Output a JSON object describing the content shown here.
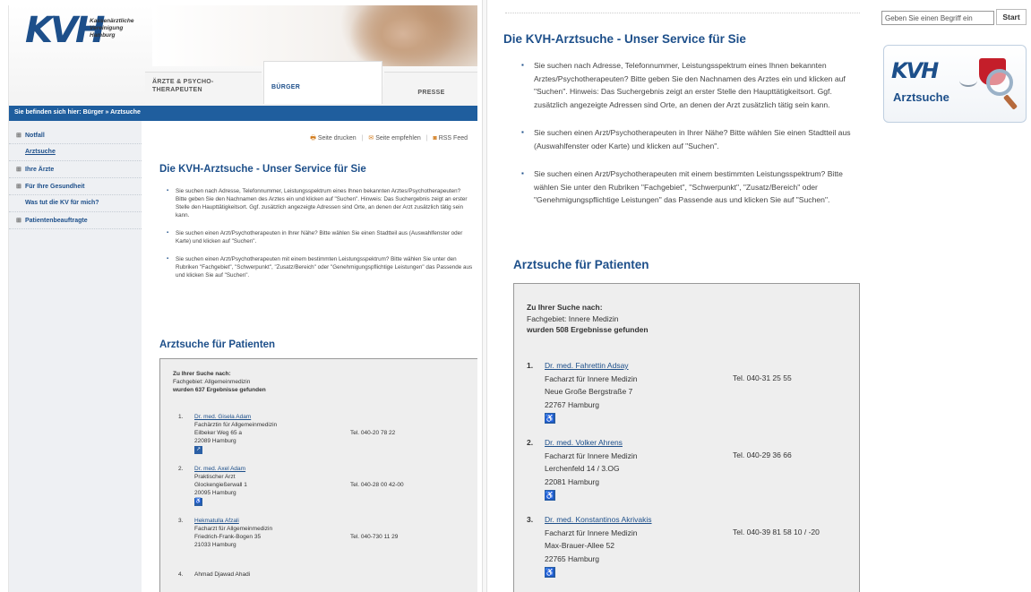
{
  "left": {
    "logo": {
      "text": "KVH",
      "name": "Kassenärztliche\nVereinigung\nHamburg"
    },
    "nav": {
      "aerzte": "ÄRZTE & PSYCHO-\nTHERAPEUTEN",
      "buerger": "BÜRGER",
      "presse": "PRESSE"
    },
    "breadcrumb": "Sie befinden sich hier: Bürger » Arztsuche",
    "sidebar": [
      {
        "label": "Notfall",
        "plus": "⊞"
      },
      {
        "label": "Arztsuche",
        "plus": ""
      },
      {
        "label": "Ihre Ärzte",
        "plus": "⊞"
      },
      {
        "label": "Für Ihre Gesundheit",
        "plus": "⊞"
      },
      {
        "label": "Was tut die KV für mich?",
        "plus": ""
      },
      {
        "label": "Patientenbeauftragte",
        "plus": "⊞"
      }
    ],
    "tools": {
      "print": "Seite drucken",
      "recommend": "Seite empfehlen",
      "rss": "RSS Feed"
    },
    "title": "Die KVH-Arztsuche - Unser Service für Sie",
    "bullets": [
      "Sie suchen nach Adresse, Telefonnummer, Leistungsspektrum eines Ihnen bekannten Arztes/Psychotherapeuten? Bitte geben Sie den Nachnamen des Arztes ein und klicken auf \"Suchen\". Hinweis: Das Suchergebnis zeigt an erster Stelle den Haupttätigkeitsort. Ggf. zusätzlich angezeigte Adressen sind Orte, an denen der Arzt zusätzlich tätig sein kann.",
      "Sie suchen einen Arzt/Psychotherapeuten in Ihrer Nähe? Bitte wählen Sie einen Stadtteil aus (Auswahlfenster oder Karte) und klicken auf \"Suchen\".",
      "Sie suchen einen Arzt/Psychotherapeuten mit einem bestimmten Leistungsspektrum? Bitte wählen Sie unter den Rubriken \"Fachgebiet\", \"Schwerpunkt\", \"Zusatz/Bereich\" oder \"Genehmigungspflichtige Leistungen\" das Passende aus und klicken Sie auf \"Suchen\"."
    ],
    "search_title": "Arztsuche für Patienten",
    "query": {
      "heading": "Zu Ihrer Suche nach:",
      "criteria": "Fachgebiet: Allgemeinmedizin",
      "count": "wurden 637 Ergebnisse gefunden"
    },
    "results": [
      {
        "num": "1.",
        "name": "Dr. med. Gisela Adam",
        "role": "Fachärztin für Allgemeinmedizin",
        "street": "Eilbeker Weg 65 a",
        "city": "22089 Hamburg",
        "tel": "Tel. 040-20 78 22",
        "icon": "↗"
      },
      {
        "num": "2.",
        "name": "Dr. med. Axel Adam",
        "role": "Praktischer Arzt",
        "street": "Glockengießerwall 1",
        "city": "20095 Hamburg",
        "tel": "Tel. 040-28 00 42-00",
        "icon": "♿"
      },
      {
        "num": "3.",
        "name": "Hekmatulla Afzali",
        "role": "Facharzt für Allgemeinmedizin",
        "street": "Friedrich-Frank-Bogen 35",
        "city": "21033 Hamburg",
        "tel": "Tel. 040-730 11 29",
        "icon": ""
      },
      {
        "num": "4.",
        "name": "Ahmad Djawad Ahadi",
        "role": "",
        "street": "",
        "city": "",
        "tel": "",
        "icon": ""
      }
    ]
  },
  "right": {
    "title": "Die KVH-Arztsuche - Unser Service für Sie",
    "bullets": [
      "Sie suchen nach Adresse, Telefonnummer, Leistungsspektrum eines Ihnen bekannten Arztes/Psychotherapeuten? Bitte geben Sie den Nachnamen des Arztes ein und klicken auf \"Suchen\". Hinweis: Das Suchergebnis zeigt an erster Stelle den Haupttätigkeitsort. Ggf. zusätzlich angezeigte Adressen sind Orte, an denen der Arzt zusätzlich tätig sein kann.",
      "Sie suchen einen Arzt/Psychotherapeuten in Ihrer Nähe? Bitte wählen Sie einen Stadtteil aus (Auswahlfenster oder Karte) und klicken auf \"Suchen\".",
      "Sie suchen einen Arzt/Psychotherapeuten mit einem bestimmten Leistungsspektrum? Bitte wählen Sie unter den Rubriken \"Fachgebiet\", \"Schwerpunkt\", \"Zusatz/Bereich\" oder \"Genehmigungspflichtige Leistungen\" das Passende aus und klicken Sie auf \"Suchen\"."
    ],
    "search_title": "Arztsuche für Patienten",
    "query": {
      "heading": "Zu Ihrer Suche nach:",
      "criteria": "Fachgebiet: Innere Medizin",
      "count": "wurden 508 Ergebnisse gefunden"
    },
    "results": [
      {
        "num": "1.",
        "name": "Dr. med. Fahrettin Adsay",
        "role": "Facharzt für Innere Medizin",
        "street": "Neue Große Bergstraße 7",
        "city": "22767 Hamburg",
        "tel": "Tel. 040-31 25 55",
        "icon": "♿"
      },
      {
        "num": "2.",
        "name": "Dr. med. Volker Ahrens",
        "role": "Facharzt für Innere Medizin",
        "street": "Lerchenfeld 14 / 3.OG",
        "city": "22081 Hamburg",
        "tel": "Tel. 040-29 36 66",
        "icon": "♿"
      },
      {
        "num": "3.",
        "name": "Dr. med. Konstantinos Akrivakis",
        "role": "Facharzt für Innere Medizin",
        "street": "Max-Brauer-Allee 52",
        "city": "22765 Hamburg",
        "tel": "Tel. 040-39 81 58 10 / -20",
        "icon": "♿"
      }
    ]
  },
  "search": {
    "placeholder": "Geben Sie einen Begriff ein",
    "button": "Start"
  },
  "arztsuche_logo": {
    "kvh": "KVH",
    "label": "Arztsuche"
  }
}
